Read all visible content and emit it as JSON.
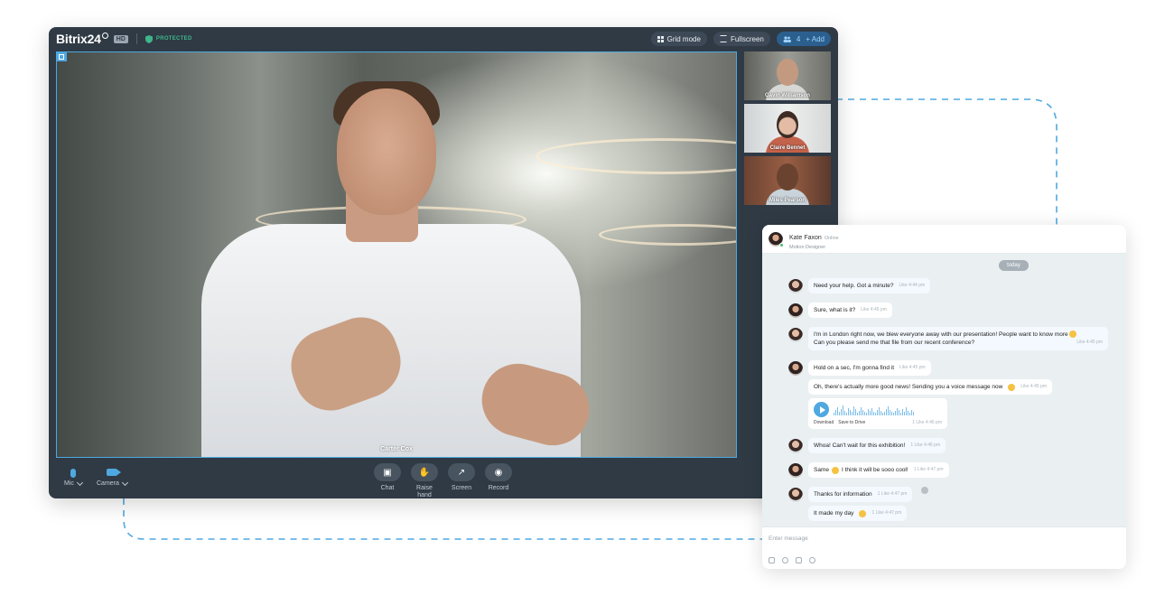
{
  "call": {
    "logo": "Bitrix24",
    "hd_badge": "HD",
    "protected_label": "PROTECTED",
    "grid_mode_label": "Grid mode",
    "fullscreen_label": "Fullscreen",
    "participants_count": "4",
    "add_label": "+ Add",
    "main_speaker": "Carter Cox",
    "thumbnails": [
      {
        "name": "Gavin Williamson"
      },
      {
        "name": "Claire Bennet"
      },
      {
        "name": "Miles Pearson"
      }
    ],
    "controls": {
      "mic": "Mic",
      "camera": "Camera",
      "chat": "Chat",
      "raise_hand_1": "Raise",
      "raise_hand_2": "hand",
      "screen": "Screen",
      "record": "Record"
    }
  },
  "chat": {
    "contact_name": "Kate Faxon",
    "contact_status": "Online",
    "contact_title": "Motion Designer",
    "day_label": "today",
    "messages": [
      {
        "text": "Need your help. Got a minute?",
        "meta": "Like 4:44 pm"
      },
      {
        "text": "Sure, what is it?",
        "meta": "Like 4:45 pm"
      },
      {
        "text1": "I'm in London right now, we blew everyone away with our presentation! People want to know more",
        "text2": "Can you please send me that file from our recent conference?",
        "meta": "Like 4:45 pm"
      },
      {
        "text": "Hold on a sec, I'm gonna find it",
        "meta": "Like 4:45 pm"
      },
      {
        "text": "Oh, there's actually more good news! Sending you a voice message now",
        "meta": "Like 4:45 pm"
      },
      {
        "download": "Download",
        "save": "Save to Drive",
        "meta": "1 Like 4:46 pm"
      },
      {
        "text": "Whoa! Can't wait for this exhibition!",
        "meta": "1 Like 4:46 pm"
      },
      {
        "text1": "Same",
        "text2": "I think it will be sooo cool!",
        "meta": "1 Like 4:47 pm"
      },
      {
        "text": "Thanks for information",
        "meta": "1 Like 4:47 pm"
      },
      {
        "text": "It made my day",
        "meta": "1 Like 4:47 pm"
      }
    ],
    "composer_placeholder": "Enter message"
  },
  "colors": {
    "accent": "#4fa8e0",
    "call_bg": "#2f3a45",
    "protected": "#3fb58a",
    "chat_bg": "#eaeff2"
  },
  "icons": [
    "shield-icon",
    "grid-icon",
    "fullscreen-icon",
    "users-icon",
    "mic-icon",
    "camera-icon",
    "chat-icon",
    "hand-icon",
    "screen-share-icon",
    "record-icon",
    "play-icon",
    "attach-icon",
    "mention-icon",
    "file-icon",
    "emoji-icon"
  ]
}
